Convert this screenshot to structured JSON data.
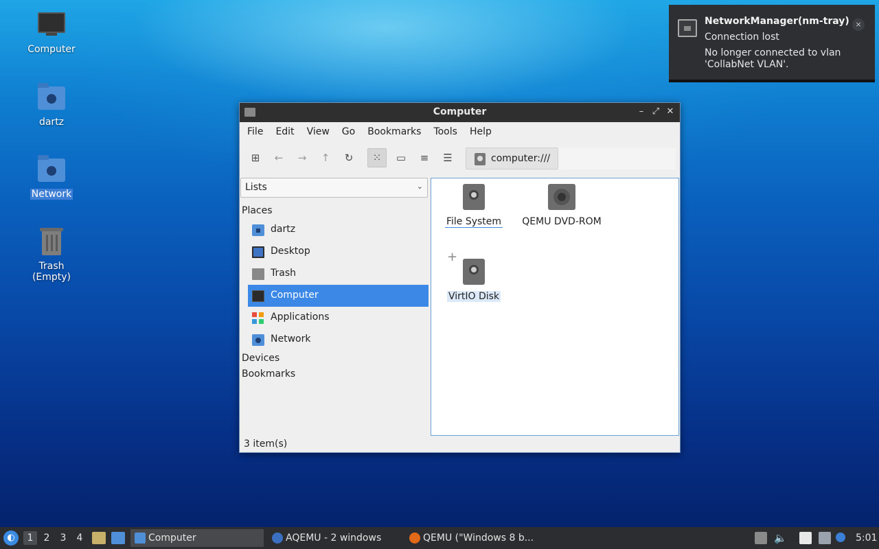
{
  "desktop": {
    "icons": [
      {
        "label": "Computer"
      },
      {
        "label": "dartz"
      },
      {
        "label": "Network"
      },
      {
        "label": "Trash (Empty)"
      }
    ]
  },
  "notification": {
    "title": "NetworkManager(nm-tray)",
    "summary": "Connection lost",
    "body": "No longer connected to vlan 'CollabNet VLAN'.",
    "close": "×"
  },
  "window": {
    "title": "Computer",
    "menu": [
      "File",
      "Edit",
      "View",
      "Go",
      "Bookmarks",
      "Tools",
      "Help"
    ],
    "path": "computer:///",
    "side_mode": "Lists",
    "sections": {
      "places": "Places",
      "devices": "Devices",
      "bookmarks": "Bookmarks"
    },
    "places": [
      {
        "label": "dartz",
        "icon": "home-folder-icon"
      },
      {
        "label": "Desktop",
        "icon": "desktop-icon"
      },
      {
        "label": "Trash",
        "icon": "trash-icon"
      },
      {
        "label": "Computer",
        "icon": "computer-icon",
        "selected": true
      },
      {
        "label": "Applications",
        "icon": "applications-icon"
      },
      {
        "label": "Network",
        "icon": "network-folder-icon"
      }
    ],
    "items": [
      {
        "label": "File System",
        "icon": "drive-icon"
      },
      {
        "label": "QEMU DVD-ROM",
        "icon": "optical-drive-icon"
      },
      {
        "label": "VirtIO Disk",
        "icon": "drive-icon"
      }
    ],
    "status": "3 item(s)"
  },
  "taskbar": {
    "workspaces": [
      "1",
      "2",
      "3",
      "4"
    ],
    "tasks": [
      {
        "label": "Computer",
        "active": true
      },
      {
        "label": "AQEMU - 2 windows"
      },
      {
        "label": "QEMU (\"Windows 8 b..."
      }
    ],
    "clock": "5:01"
  },
  "colors": {
    "selection": "#3b88e6",
    "titlebar": "#2f2f2f",
    "taskbar": "#2b2d30",
    "notification": "#2d2f33"
  }
}
